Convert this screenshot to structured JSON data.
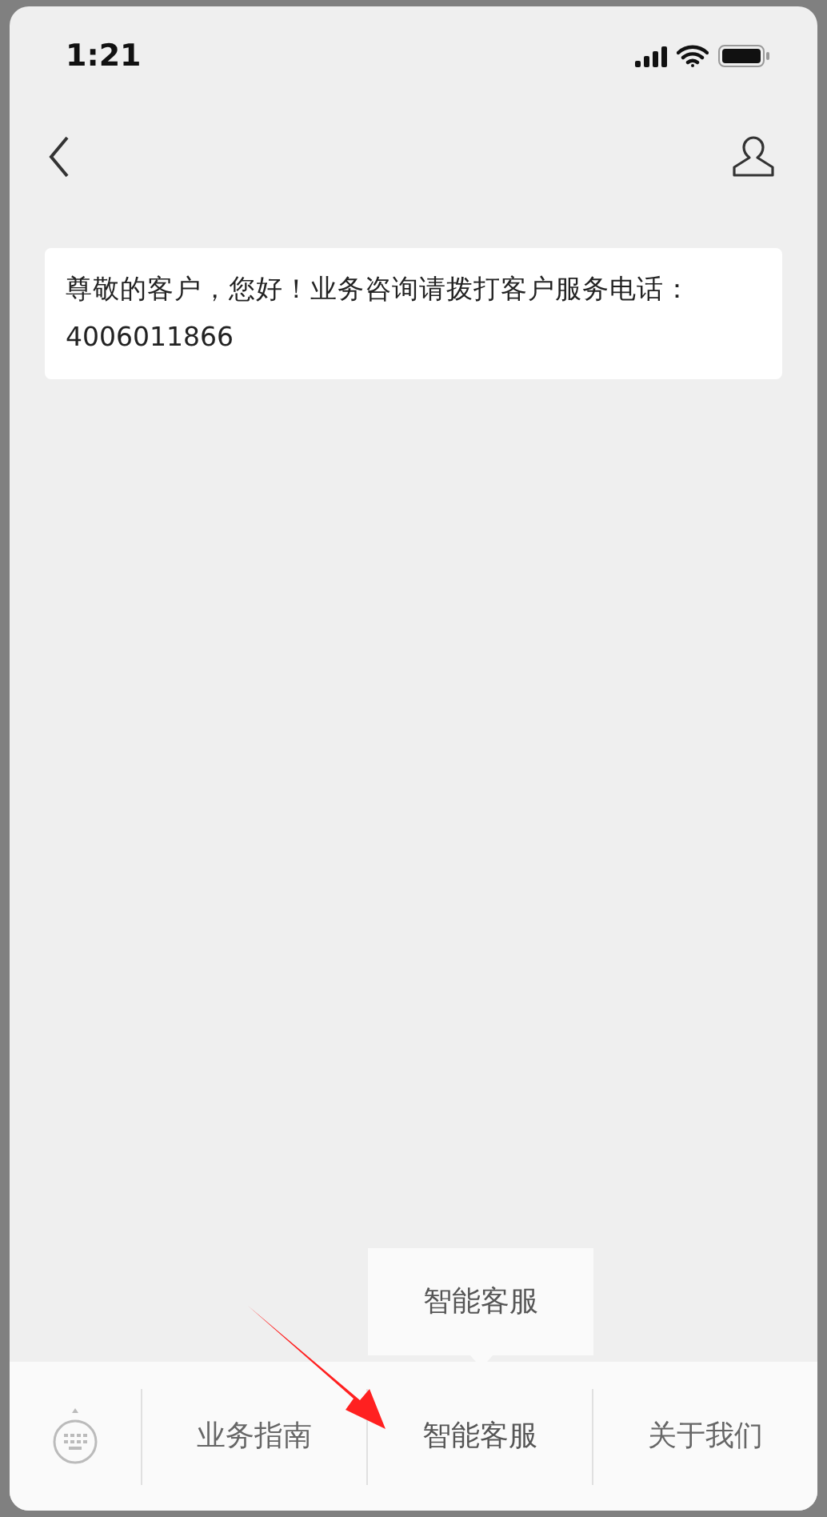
{
  "status_bar": {
    "time": "1:21"
  },
  "messages": [
    {
      "text": "尊敬的客户，您好！业务咨询请拨打客户服务电话：4006011866"
    }
  ],
  "bottom_menu": [
    {
      "label": "业务指南",
      "expanded": false
    },
    {
      "label": "智能客服",
      "expanded": true,
      "submenu": [
        {
          "label": "智能客服"
        }
      ]
    },
    {
      "label": "关于我们",
      "expanded": false
    }
  ]
}
